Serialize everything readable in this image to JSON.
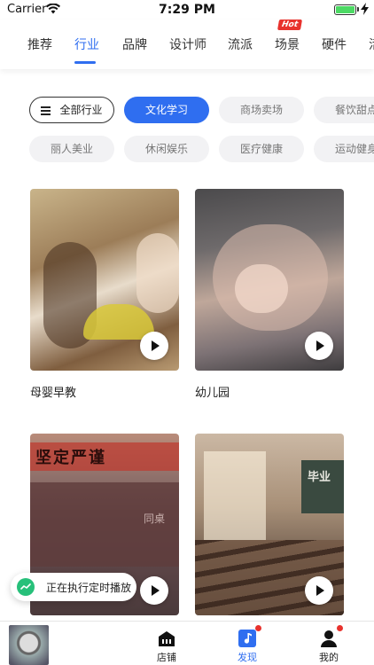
{
  "status_bar": {
    "carrier": "Carrier",
    "time": "7:29 PM"
  },
  "nav_tabs": {
    "items": [
      {
        "label": "推荐"
      },
      {
        "label": "行业"
      },
      {
        "label": "品牌"
      },
      {
        "label": "设计师"
      },
      {
        "label": "流派"
      },
      {
        "label": "场景"
      },
      {
        "label": "硬件"
      },
      {
        "label": "活"
      }
    ],
    "active_index": 1,
    "hot_badge": "Hot"
  },
  "filters": {
    "all_label": "全部行业",
    "row1": [
      {
        "label": "文化学习"
      },
      {
        "label": "商场卖场"
      },
      {
        "label": "餐饮甜点"
      }
    ],
    "row2": [
      {
        "label": "丽人美业"
      },
      {
        "label": "休闲娱乐"
      },
      {
        "label": "医疗健康"
      },
      {
        "label": "运动健身"
      }
    ],
    "selected": "文化学习"
  },
  "cards": [
    {
      "caption": "母婴早教"
    },
    {
      "caption": "幼儿园"
    },
    {
      "caption": "",
      "image_text": "坚定严谨",
      "board_text": "同桌"
    },
    {
      "caption": "",
      "board_text": "毕业"
    }
  ],
  "toast": {
    "text": "正在执行定时播放"
  },
  "tabbar": {
    "items": [
      {
        "label": "店铺"
      },
      {
        "label": "发现"
      },
      {
        "label": "我的"
      }
    ],
    "active_index": 1
  },
  "colors": {
    "accent": "#2f6ef0",
    "hot": "#e8322d",
    "toast_icon": "#27c07a"
  }
}
